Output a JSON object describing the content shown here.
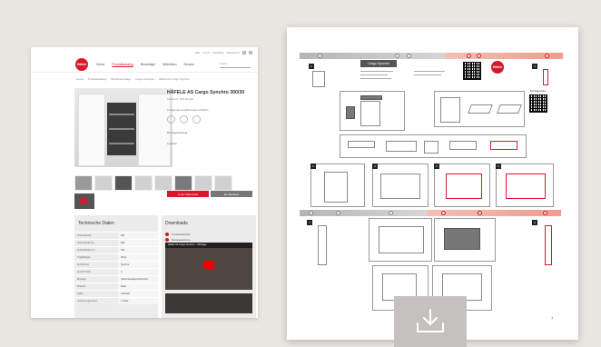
{
  "webpage": {
    "utility_links": [
      "Hilfe",
      "Konto",
      "Merkliste",
      "Warenkorb"
    ],
    "logo_text": "Häfele",
    "nav_items": [
      "Home",
      "Produktkatalog",
      "Beschläge",
      "Möbelbau",
      "Service"
    ],
    "active_nav_index": 1,
    "search_placeholder": "Suche",
    "breadcrumbs": [
      "Home",
      "Produktkatalog",
      "Möbelbeschläge",
      "Cargo-Auszüge",
      "Häfele AS Cargo Synchro"
    ],
    "product_title": "HÄFELE AS Cargo Synchro 300/30",
    "product_subtitle": "Artikel-Nr. 545.61.210",
    "product_desc": "In folgenden Ausführungen erhältlich",
    "downloads_link": "Montageanleitung",
    "stock_text": "Lieferbar",
    "add_cart_label": "In den Warenkorb",
    "wishlist_label": "Zur Merkliste",
    "sample_label": "Muster anfordern",
    "tech_title": "Technische Daten",
    "tech_rows": [
      {
        "k": "Schrankbreite",
        "v": "300"
      },
      {
        "k": "Schranktiefe min.",
        "v": "500"
      },
      {
        "k": "Schrankhöhe min.",
        "v": "720"
      },
      {
        "k": "Tragfähigkeit",
        "v": "30 kg"
      },
      {
        "k": "Ausführung",
        "v": "Synchro"
      },
      {
        "k": "Anzahl Körbe",
        "v": "3"
      },
      {
        "k": "Montage",
        "v": "Seitenmontage links/rechts"
      },
      {
        "k": "Material",
        "v": "Stahl"
      },
      {
        "k": "Farbe",
        "v": "Anthrazit"
      },
      {
        "k": "Verpackungseinheit",
        "v": "1 Stück"
      }
    ],
    "downloads_title": "Downloads",
    "download_items": [
      "Produktdatenblatt",
      "Montageanleitung"
    ],
    "video_title": "Häfele AS Cargo Synchro – Montage"
  },
  "document": {
    "title": "Cargo Synchro",
    "logo_text": "Häfele",
    "qr_label": "Montagevideo",
    "page_number": "1",
    "step_numbers": [
      "1",
      "2",
      "3",
      "4",
      "5",
      "6",
      "7",
      "8"
    ]
  },
  "download_button": {
    "icon": "download-icon"
  },
  "colors": {
    "brand_red": "#d8192b",
    "page_bg": "#e9e6e2",
    "download_btn_bg": "#c4c2bf"
  }
}
